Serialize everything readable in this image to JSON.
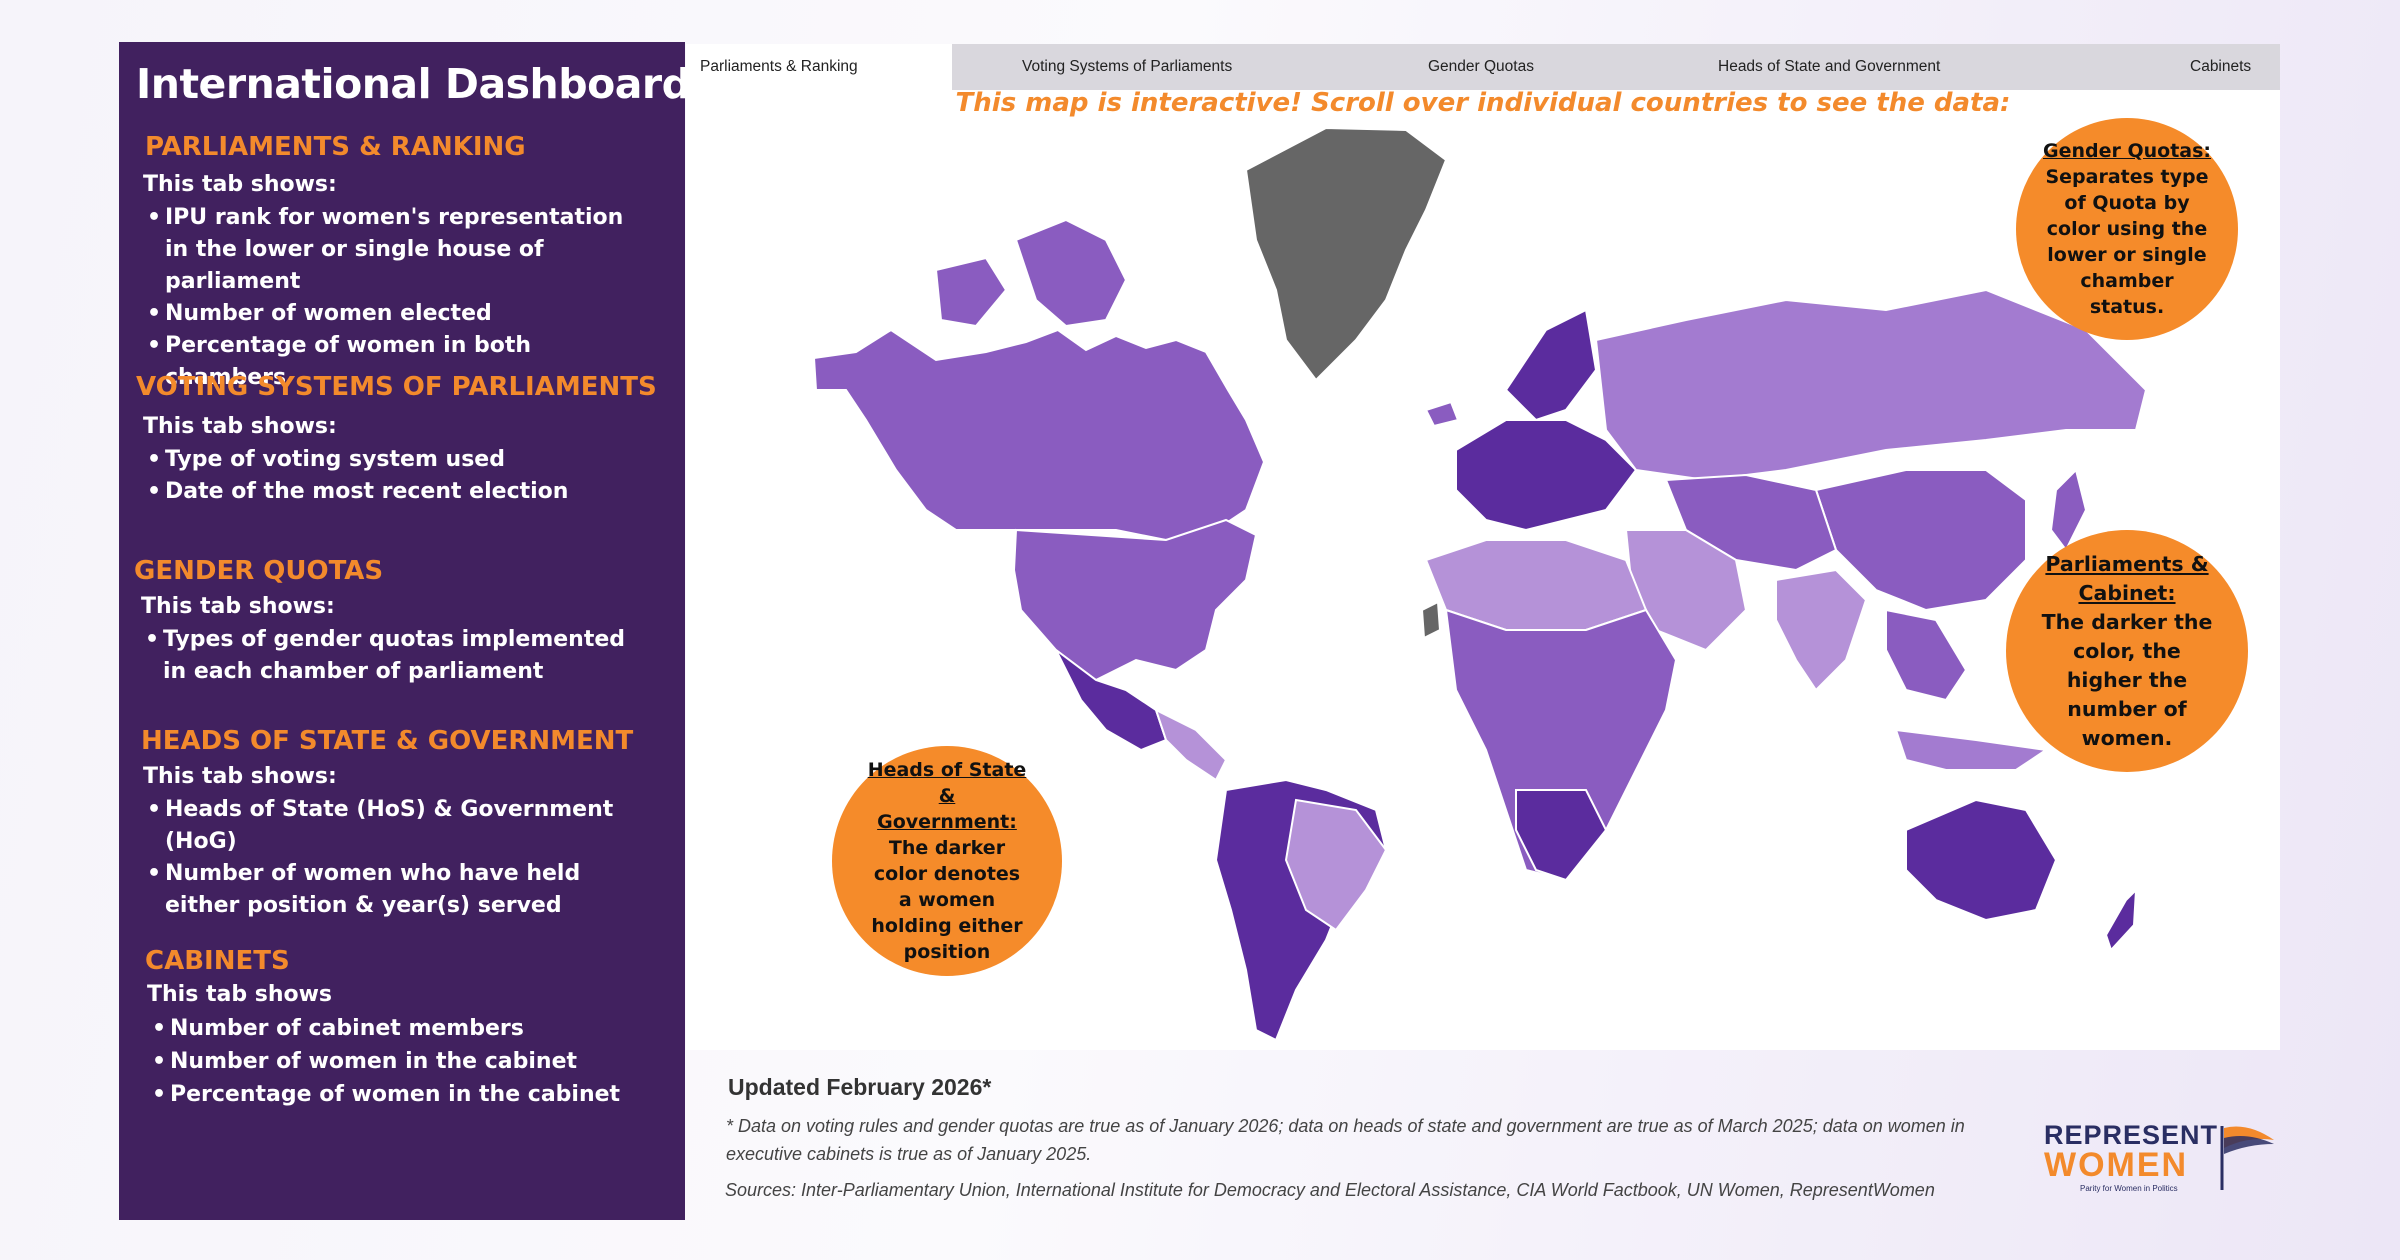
{
  "sidebar": {
    "title": "International Dashboard",
    "sections": [
      {
        "heading": "PARLIAMENTS & RANKING",
        "sub": "This tab shows:",
        "items": [
          "IPU rank for women's representation in the lower or single house of parliament",
          "Number of women elected",
          "Percentage of women in both chambers"
        ]
      },
      {
        "heading": "VOTING SYSTEMS OF PARLIAMENTS",
        "sub": "This tab shows:",
        "items": [
          "Type of voting system used",
          "Date of the most recent election"
        ]
      },
      {
        "heading": "GENDER QUOTAS",
        "sub": "This tab shows:",
        "items": [
          "Types of gender quotas implemented in each chamber of parliament"
        ]
      },
      {
        "heading": "HEADS OF STATE & GOVERNMENT",
        "sub": "This tab shows:",
        "items": [
          "Heads of State (HoS) & Government (HoG)",
          "Number of women who have held either position & year(s) served"
        ]
      },
      {
        "heading": "CABINETS",
        "sub": "This tab shows",
        "items": [
          "Number of cabinet members",
          "Number of women in the cabinet",
          "Percentage of women in the cabinet"
        ]
      }
    ]
  },
  "tabs": [
    {
      "label": "Parliaments & Ranking",
      "active": true
    },
    {
      "label": "Voting Systems of Parliaments",
      "active": false
    },
    {
      "label": "Gender Quotas",
      "active": false
    },
    {
      "label": "Heads of State and Government",
      "active": false
    },
    {
      "label": "Cabinets",
      "active": false
    }
  ],
  "map": {
    "prompt": "This map is interactive! Scroll over individual countries to see the data:"
  },
  "callouts": {
    "gender_quotas": {
      "title": "Gender Quotas:",
      "body": "Separates type of Quota by color using the lower or single chamber status."
    },
    "parliaments_cabinet": {
      "title": "Parliaments & Cabinet:",
      "body": "The darker the color, the higher the number of women."
    },
    "heads_of_state": {
      "title": "Heads of State & Government:",
      "body": "The darker color denotes a women holding either position"
    }
  },
  "footer": {
    "updated": "Updated February 2026*",
    "note": "* Data on voting rules and gender quotas are true as of January 2026; data on heads of state and government are true as of March 2025; data on women in executive cabinets is true as of January 2025.",
    "sources": "Sources: Inter-Parliamentary Union, International Institute for Democracy and Electoral Assistance, CIA World Factbook, UN Women, RepresentWomen"
  },
  "logo": {
    "line1": "REPRESENT",
    "line2": "WOMEN",
    "tagline": "Parity for Women in Politics"
  },
  "colors": {
    "panel": "#41215f",
    "accent": "#f38a2c",
    "map_dark": "#5b2c9e",
    "map_mid": "#8a5cc0",
    "map_light": "#b592d8",
    "map_nodata": "#666666"
  }
}
